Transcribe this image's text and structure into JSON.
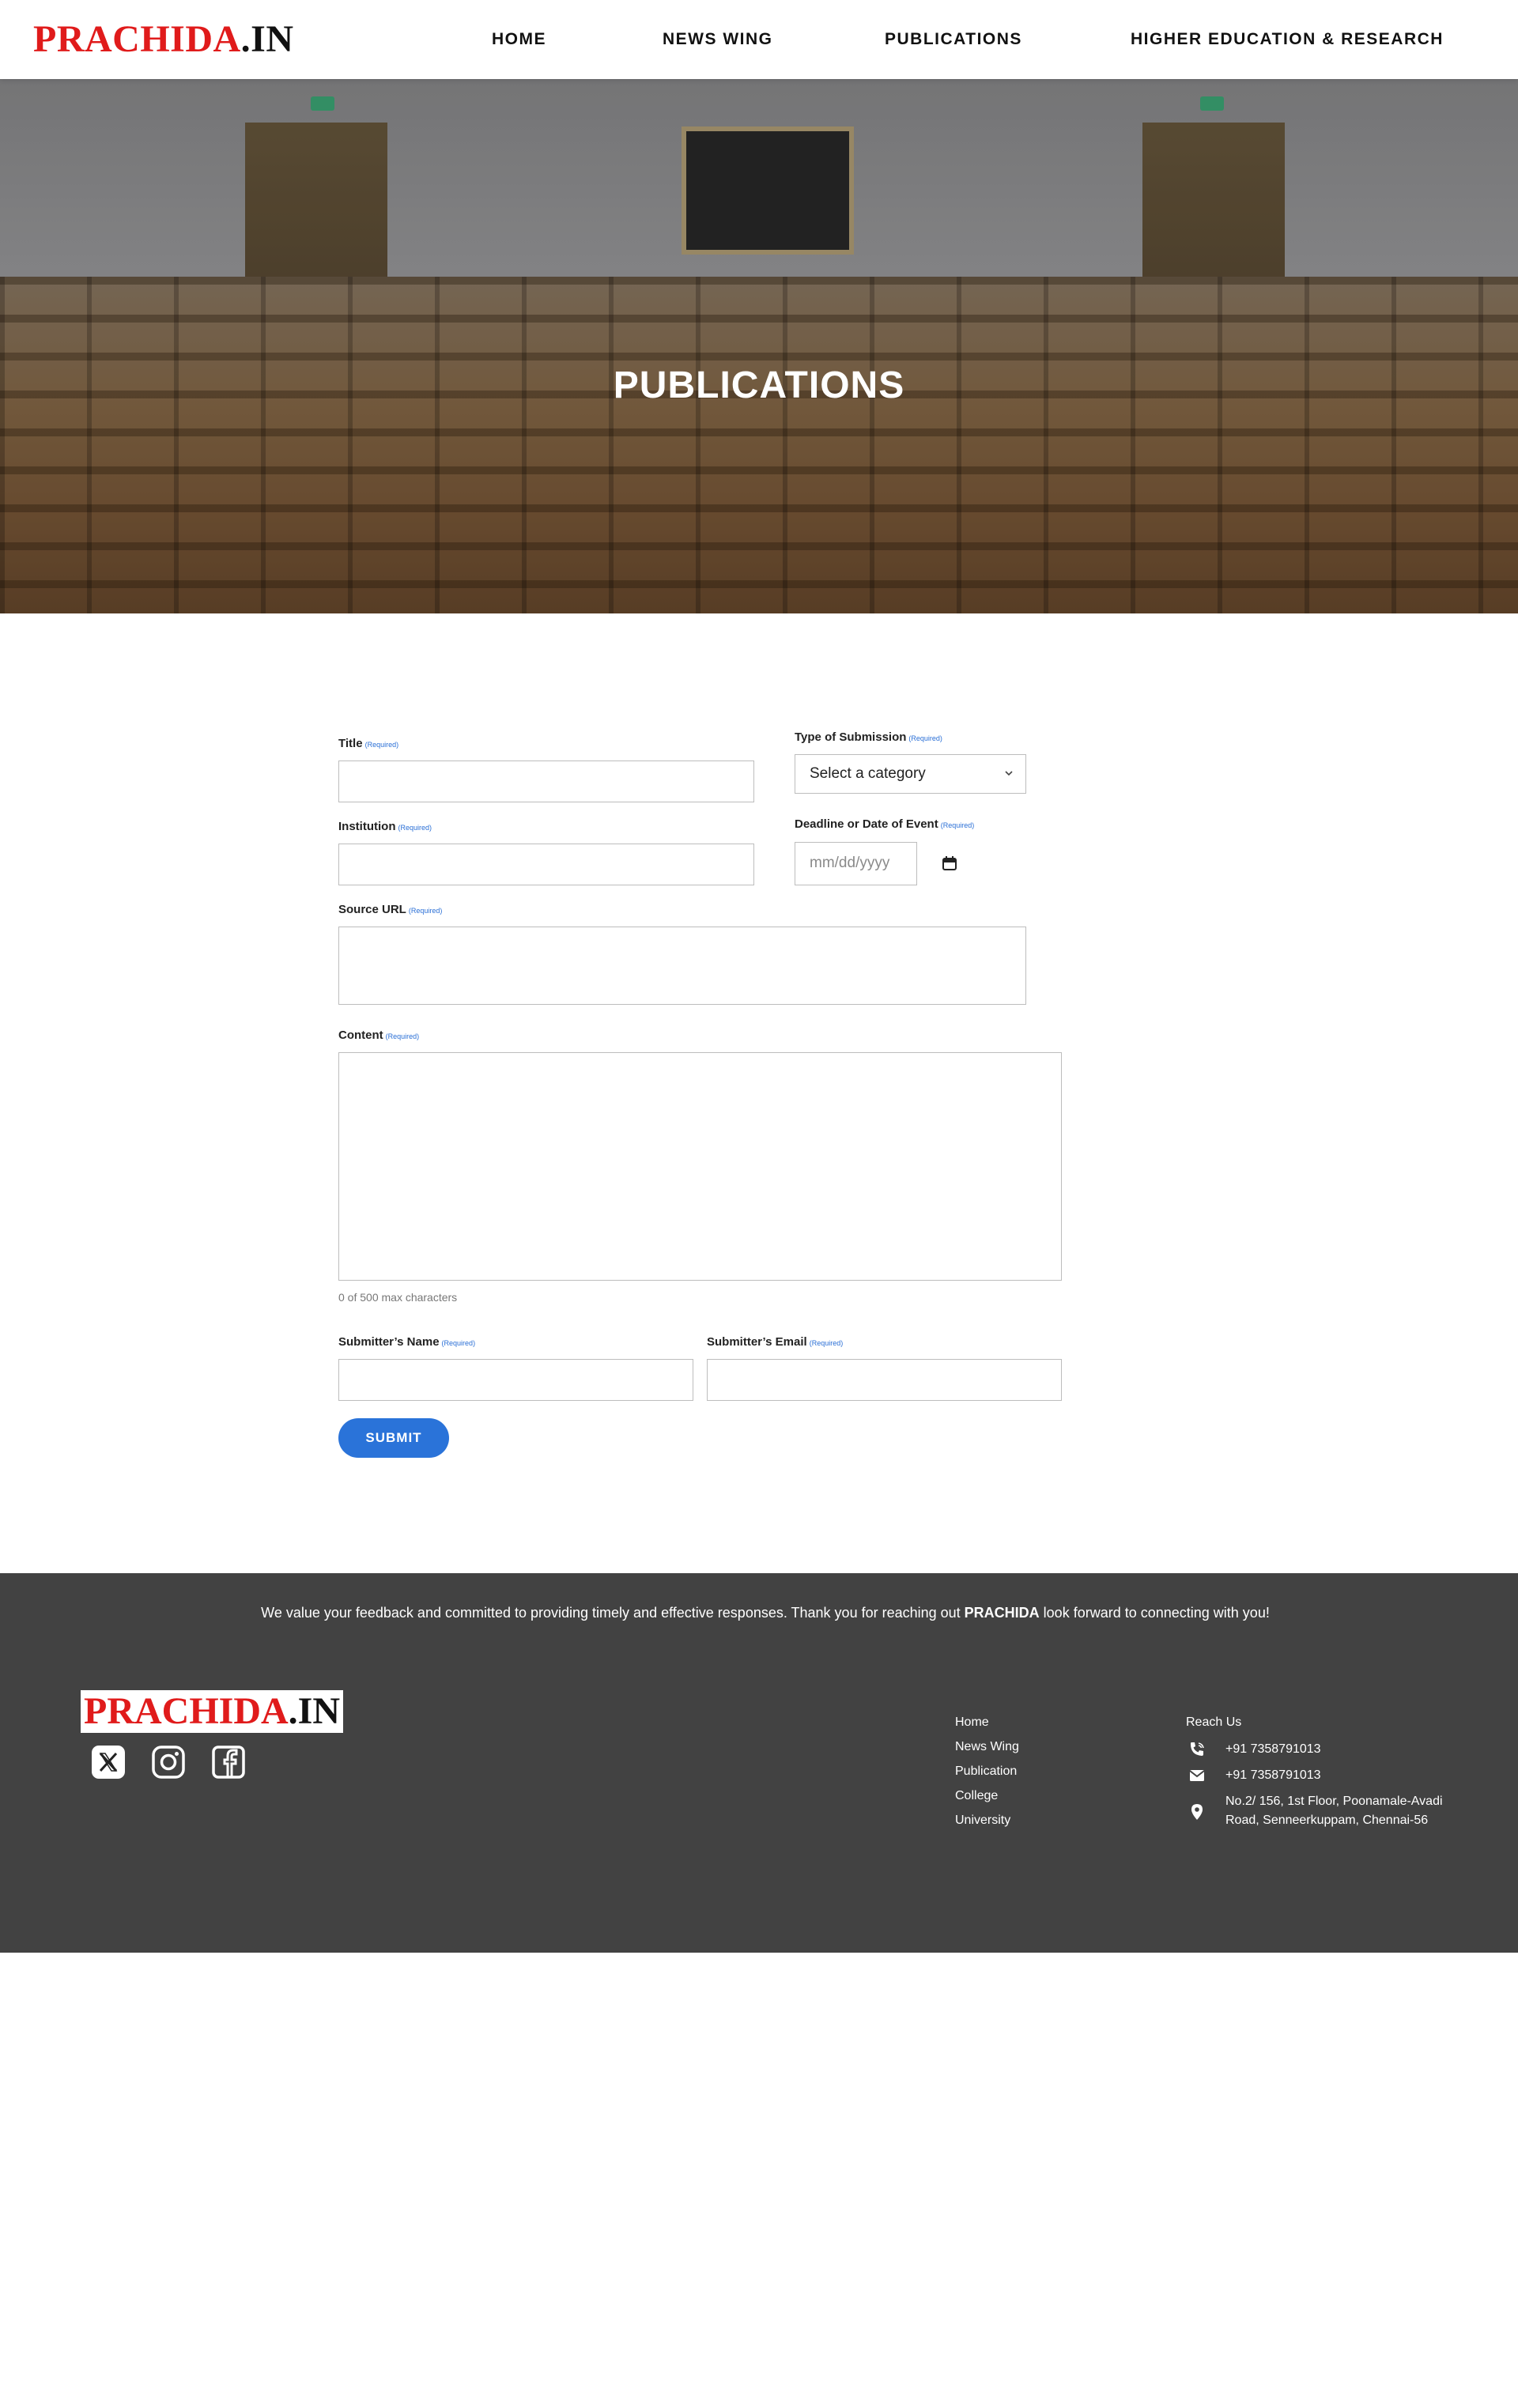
{
  "header": {
    "logo_red": "PRACHIDA",
    "logo_dark": ".IN",
    "nav": [
      "HOME",
      "NEWS WING",
      "PUBLICATIONS",
      "HIGHER EDUCATION & RESEARCH"
    ]
  },
  "hero": {
    "title": "PUBLICATIONS"
  },
  "form": {
    "required_tag": "(Required)",
    "title_label": "Title",
    "type_label": "Type of Submission",
    "type_selected": "Select a category",
    "institution_label": "Institution",
    "deadline_label": "Deadline or Date of Event",
    "date_placeholder": "mm/dd/yyyy",
    "source_label": "Source URL",
    "content_label": "Content",
    "char_count": "0 of 500 max characters",
    "name_label": "Submitter’s Name",
    "email_label": "Submitter’s Email",
    "submit_label": "SUBMIT"
  },
  "footer": {
    "message_part1": "We value your feedback and  committed to providing timely and effective responses. Thank you for reaching out ",
    "message_brand": "PRACHIDA",
    "message_part2": "  look forward to connecting with you!",
    "logo_red": "PRACHIDA",
    "logo_dark": ".IN",
    "links": [
      "Home",
      "News Wing",
      "Publication",
      "College",
      "University"
    ],
    "reach_title": "Reach Us",
    "phone1": "+91 7358791013",
    "phone2": "+91 7358791013",
    "address": "No.2/ 156, 1st Floor, Poonamale-Avadi Road, Senneerkuppam, Chennai-56",
    "icons": [
      "x-twitter-icon",
      "instagram-icon",
      "facebook-icon",
      "phone-icon",
      "mail-icon",
      "location-icon"
    ]
  }
}
